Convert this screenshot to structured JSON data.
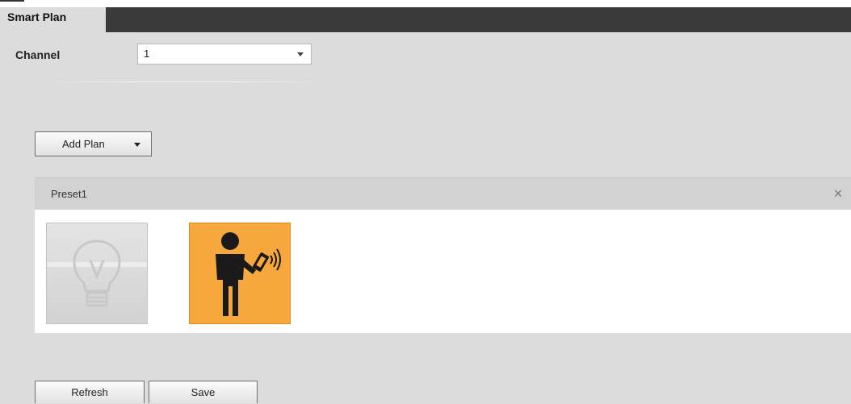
{
  "tab": {
    "label": "Smart Plan"
  },
  "channel": {
    "label": "Channel",
    "value": "1"
  },
  "add_plan": {
    "label": "Add Plan"
  },
  "plan": {
    "title": "Preset1",
    "close_symbol": "×",
    "icons": [
      {
        "name": "light-bulb",
        "state": "inactive"
      },
      {
        "name": "person-with-phone",
        "state": "active"
      }
    ]
  },
  "footer": {
    "refresh_label": "Refresh",
    "save_label": "Save"
  },
  "colors": {
    "active_tile": "#f7a83c",
    "tab_bar": "#3a3a3a",
    "background": "#dcdcdc"
  }
}
